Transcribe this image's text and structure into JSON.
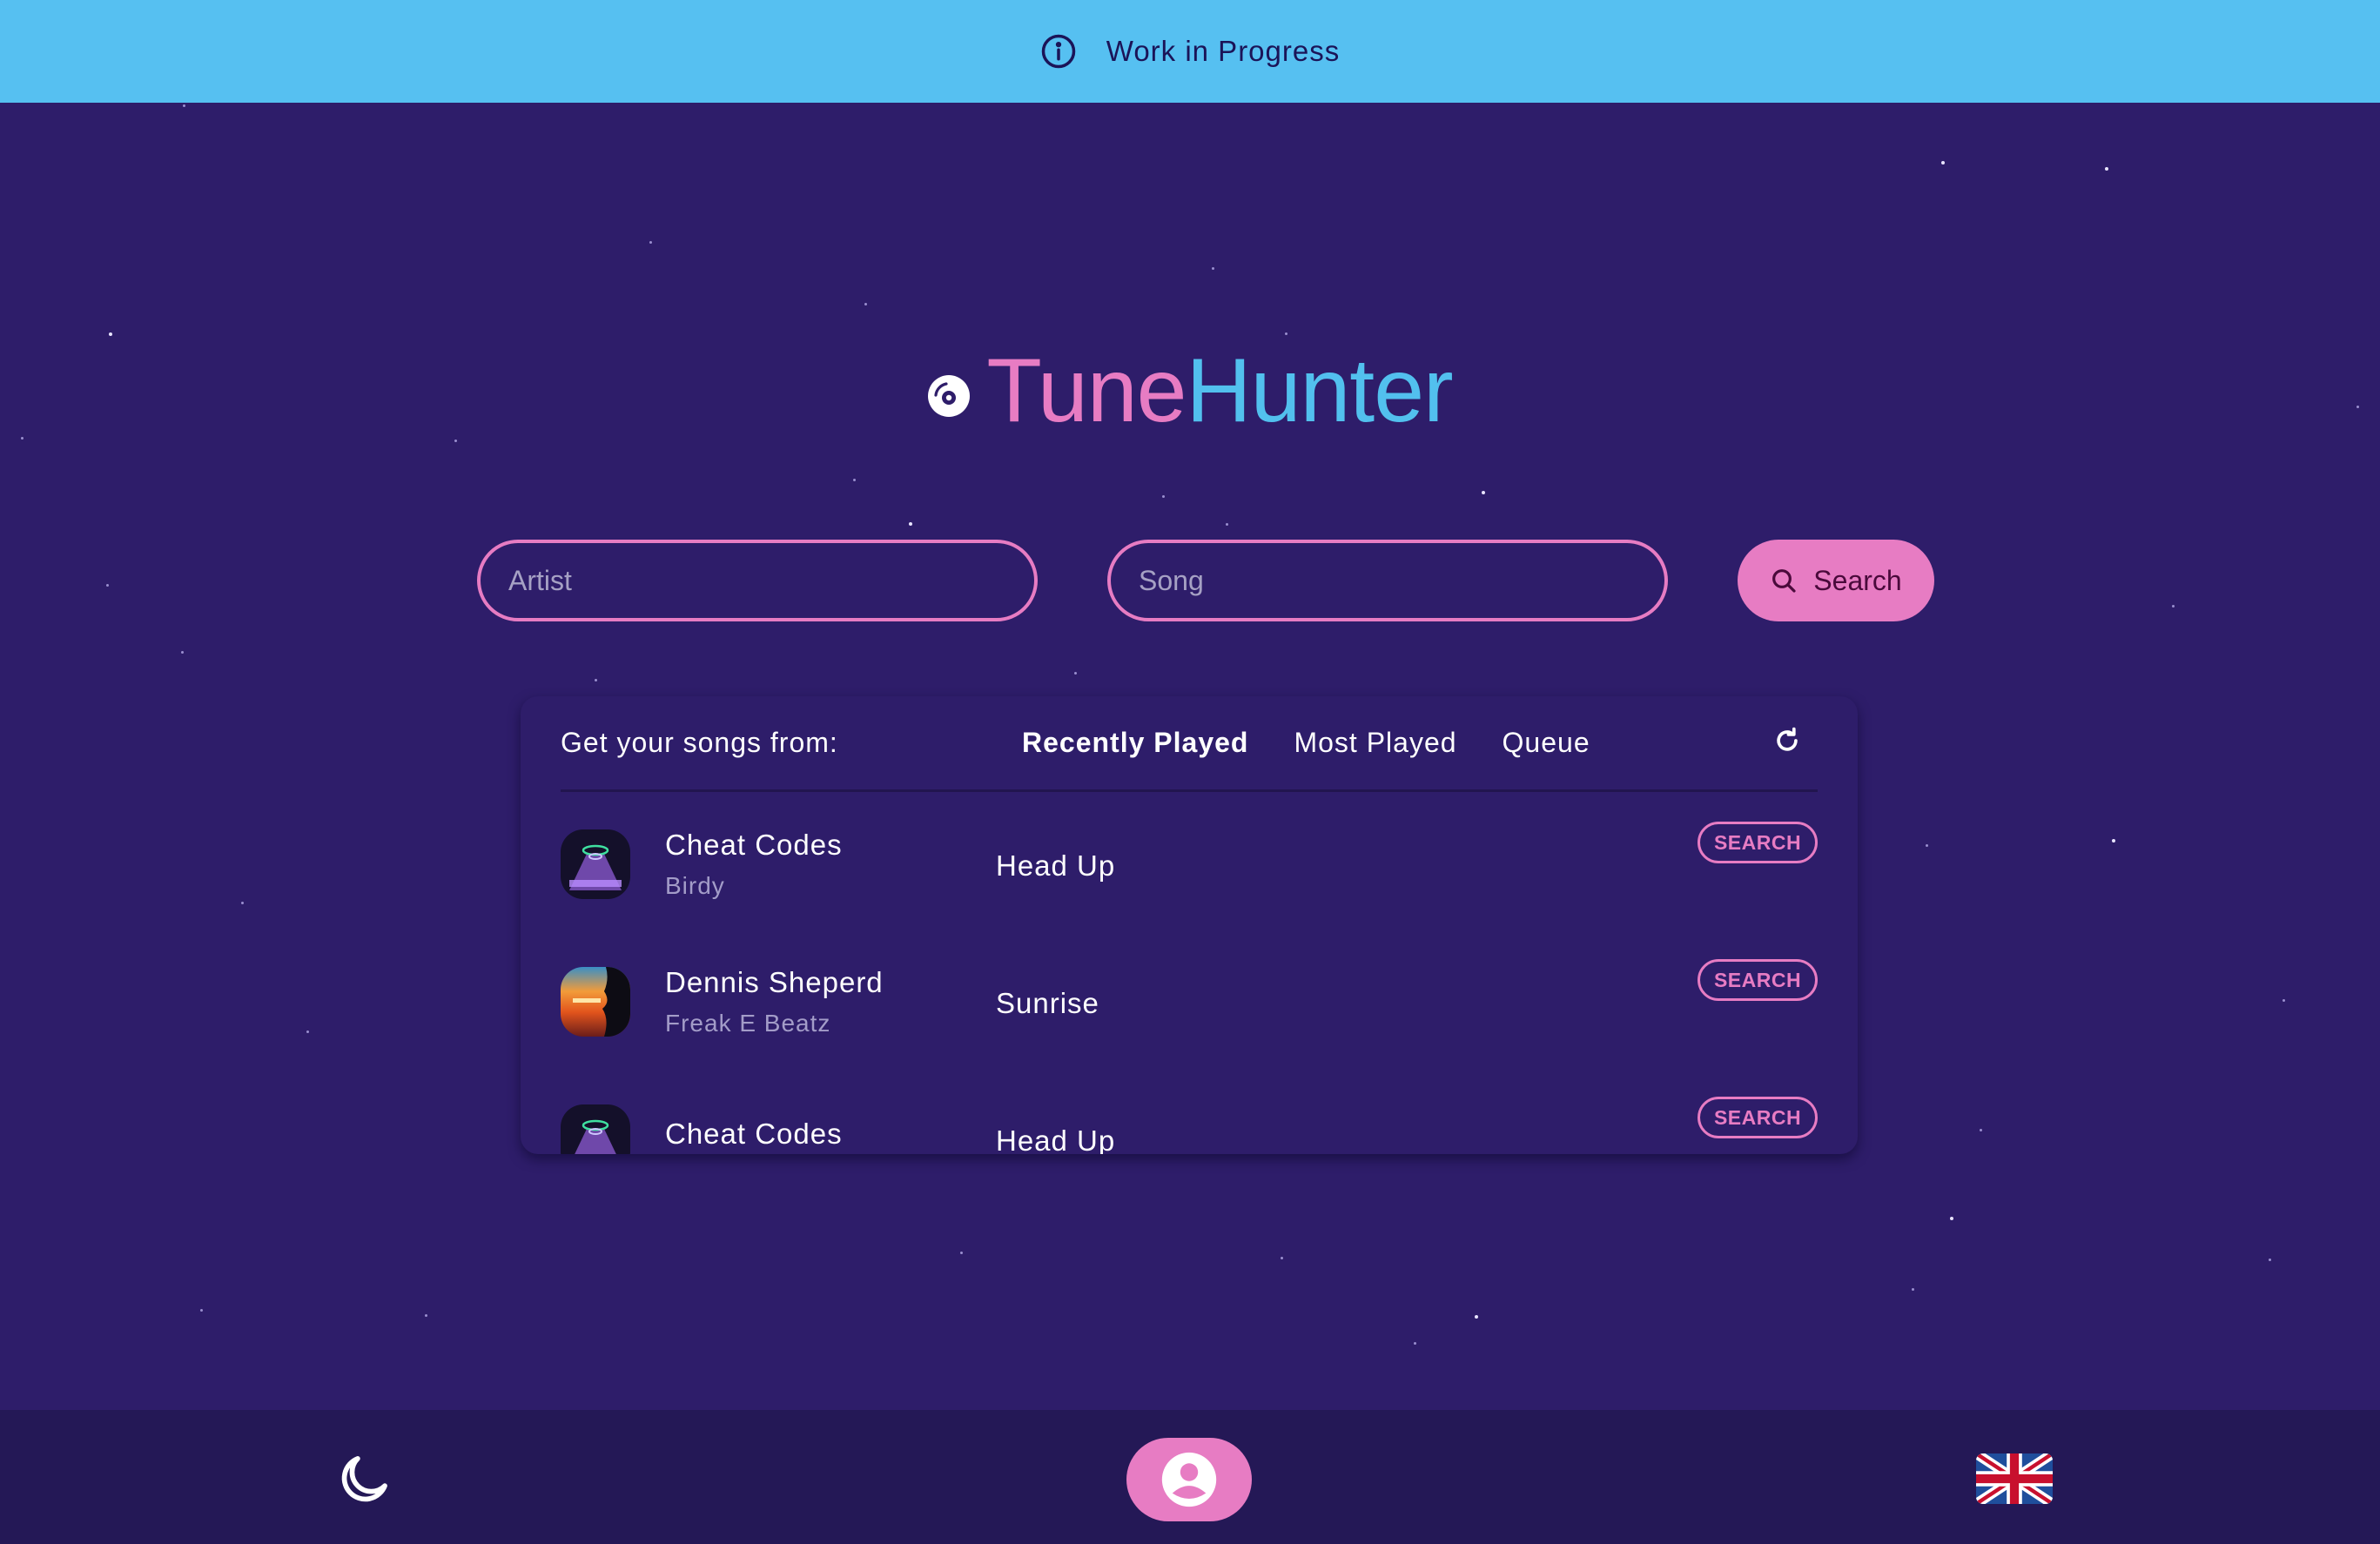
{
  "banner": {
    "icon": "info-icon",
    "text": "Work in Progress"
  },
  "logo": {
    "icon": "disc-icon",
    "part1": "Tune",
    "part2": "Hunter"
  },
  "search": {
    "artist_placeholder": "Artist",
    "artist_value": "",
    "song_placeholder": "Song",
    "song_value": "",
    "button_label": "Search",
    "button_icon": "search-icon"
  },
  "sources": {
    "label": "Get your songs from:",
    "tabs": [
      {
        "label": "Recently Played",
        "active": true
      },
      {
        "label": "Most Played",
        "active": false
      },
      {
        "label": "Queue",
        "active": false
      }
    ],
    "refresh_icon": "refresh-icon"
  },
  "songs": [
    {
      "artist": "Cheat Codes",
      "album_artist": "Birdy",
      "title": "Head Up",
      "button": "SEARCH",
      "cover": "head-up-cover"
    },
    {
      "artist": "Dennis Sheperd",
      "album_artist": "Freak E Beatz",
      "title": "Sunrise",
      "button": "SEARCH",
      "cover": "sunrise-cover"
    },
    {
      "artist": "Cheat Codes",
      "album_artist": "",
      "title": "Head Up",
      "button": "SEARCH",
      "cover": "head-up-cover"
    }
  ],
  "footer": {
    "theme_icon": "moon-icon",
    "profile_icon": "user-icon",
    "language_icon": "uk-flag-icon"
  },
  "colors": {
    "background": "#2e1d6a",
    "banner": "#56c0f1",
    "pink": "#e77cc3",
    "blue": "#52c0ee",
    "footer": "#241856"
  }
}
